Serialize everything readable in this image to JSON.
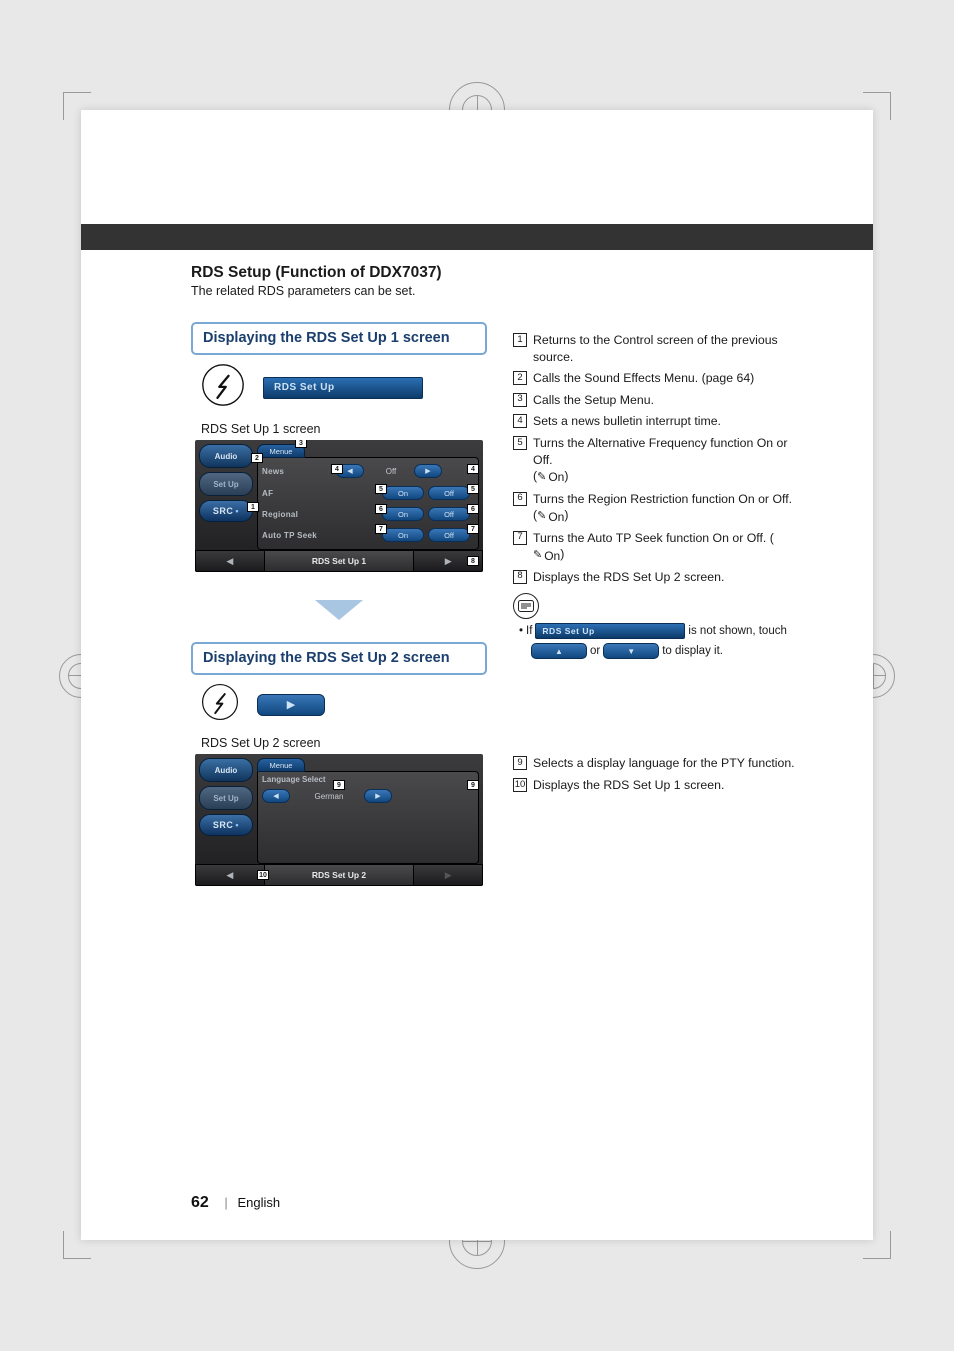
{
  "page": {
    "number": "62",
    "language": "English"
  },
  "section": {
    "title": "RDS Setup (Function of DDX7037)",
    "subtitle": "The related RDS parameters can be set."
  },
  "block1": {
    "heading": "Displaying the RDS Set Up 1 screen",
    "menu_btn_label": "RDS Set Up",
    "caption": "RDS Set Up 1 screen",
    "screen": {
      "left_buttons": {
        "audio": "Audio",
        "setup": "Set Up",
        "src": "SRC"
      },
      "menu_tab": "Menue",
      "rows": {
        "news": {
          "label": "News",
          "value": "Off"
        },
        "af": {
          "label": "AF",
          "on": "On",
          "off": "Off"
        },
        "regional": {
          "label": "Regional",
          "on": "On",
          "off": "Off"
        },
        "autotp": {
          "label": "Auto TP Seek",
          "on": "On",
          "off": "Off"
        }
      },
      "bottom_title": "RDS Set Up 1"
    },
    "callouts": [
      "1",
      "2",
      "3",
      "4",
      "5",
      "6",
      "7",
      "8"
    ]
  },
  "block2": {
    "heading": "Displaying the RDS Set Up 2 screen",
    "caption": "RDS Set Up 2 screen",
    "screen": {
      "left_buttons": {
        "audio": "Audio",
        "setup": "Set Up",
        "src": "SRC"
      },
      "menu_tab": "Menue",
      "lang": {
        "label": "Language Select",
        "value": "German"
      },
      "bottom_title": "RDS Set Up 2"
    },
    "callouts_left": "10",
    "callouts_right": "9"
  },
  "descriptions1": [
    {
      "n": "1",
      "t": "Returns to the Control screen of the previous source."
    },
    {
      "n": "2",
      "t": "Calls the Sound Effects Menu. (page 64)"
    },
    {
      "n": "3",
      "t": "Calls the Setup Menu."
    },
    {
      "n": "4",
      "t": "Sets a news bulletin interrupt time."
    },
    {
      "n": "5",
      "t": "Turns the Alternative Frequency function On or Off.",
      "default": "On"
    },
    {
      "n": "6",
      "t": "Turns the Region Restriction function On or Off.",
      "default": "On"
    },
    {
      "n": "7",
      "t": "Turns the Auto TP Seek function On or Off.",
      "default_inline": "On"
    },
    {
      "n": "8",
      "t": "Displays the RDS Set Up 2 screen."
    }
  ],
  "note1": {
    "prefix": "If",
    "menu_label": "RDS Set Up",
    "mid": "is not shown, touch",
    "or": "or",
    "suffix": "to display it."
  },
  "descriptions2": [
    {
      "n": "9",
      "t": "Selects a display language for the PTY function."
    },
    {
      "n": "10",
      "t": "Displays the RDS Set Up 1 screen."
    }
  ]
}
